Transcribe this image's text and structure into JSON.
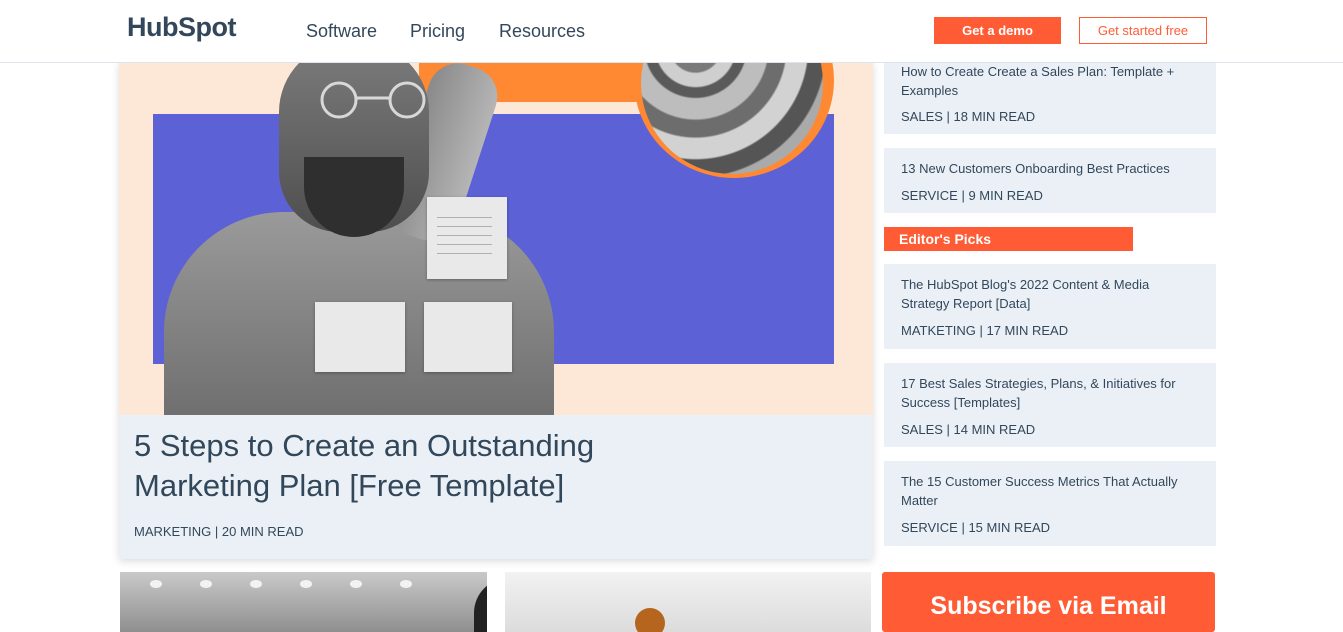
{
  "header": {
    "logo": "HubSpot",
    "nav": [
      "Software",
      "Pricing",
      "Resources"
    ],
    "demo_label": "Get a demo",
    "start_label": "Get started free"
  },
  "featured": {
    "title": "5 Steps to Create an Outstanding Marketing Plan [Free Template]",
    "meta": "MARKETING | 20 MIN READ"
  },
  "sidebar": {
    "top_cards": [
      {
        "title": "How to Create Create a Sales Plan: Template + Examples",
        "meta": "SALES | 18 MIN READ"
      },
      {
        "title": "13 New Customers Onboarding Best Practices",
        "meta": "SERVICE | 9 MIN READ"
      }
    ],
    "editors_label": "Editor's Picks",
    "picks": [
      {
        "title": "The HubSpot Blog's 2022 Content & Media Strategy Report [Data]",
        "meta": "MATKETING | 17 MIN READ"
      },
      {
        "title": "17 Best Sales Strategies, Plans, & Initiatives for Success [Templates]",
        "meta": "SALES | 14 MIN READ"
      },
      {
        "title": "The 15 Customer Success Metrics That Actually Matter",
        "meta": "SERVICE | 15 MIN READ"
      }
    ]
  },
  "subscribe": {
    "label": "Subscribe via Email"
  },
  "colors": {
    "brand": "#ff5c35",
    "text": "#33475b",
    "card_bg": "#eaf0f6",
    "hero_purple": "#5c62d6",
    "hero_orange": "#ff8933"
  }
}
